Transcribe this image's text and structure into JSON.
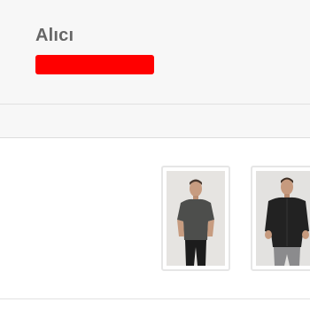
{
  "recipient": {
    "label": "Alıcı",
    "redaction_color": "#ff0000"
  },
  "products": [
    {
      "image": "man-in-dark-grey-tshirt-photo"
    },
    {
      "image": "man-in-black-shirt-photo"
    }
  ],
  "colors": {
    "header_bg": "#f7f7f7",
    "label_text": "#666666",
    "divider": "#e0e0e0",
    "thumb_border": "#e6e6e6"
  }
}
